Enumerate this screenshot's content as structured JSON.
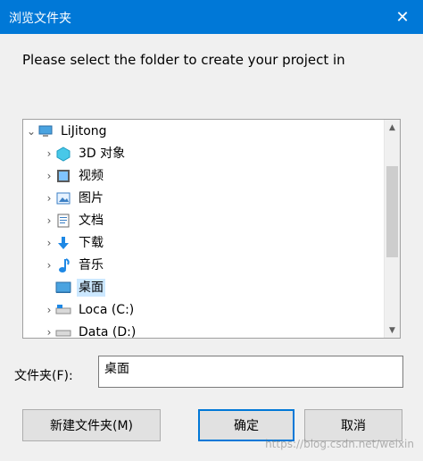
{
  "window": {
    "title": "浏览文件夹"
  },
  "instruction": "Please select the folder to create your project in",
  "tree": {
    "root": {
      "label": "LiJitong",
      "icon": "computer-icon"
    },
    "items": [
      {
        "label": "3D 对象",
        "icon": "3d-objects-icon"
      },
      {
        "label": "视频",
        "icon": "video-icon"
      },
      {
        "label": "图片",
        "icon": "pictures-icon"
      },
      {
        "label": "文档",
        "icon": "documents-icon"
      },
      {
        "label": "下载",
        "icon": "download-icon"
      },
      {
        "label": "音乐",
        "icon": "music-icon"
      },
      {
        "label": "桌面",
        "icon": "desktop-icon",
        "selected": true
      },
      {
        "label": "Loca (C:)",
        "icon": "drive-icon"
      },
      {
        "label": "Data (D:)",
        "icon": "drive-icon"
      }
    ]
  },
  "folder": {
    "label": "文件夹(F):",
    "value": "桌面"
  },
  "buttons": {
    "new_folder": "新建文件夹(M)",
    "ok": "确定",
    "cancel": "取消"
  },
  "watermark": "https://blog.csdn.net/weixin",
  "colors": {
    "accent": "#0078d7",
    "selection": "#cce8ff"
  }
}
